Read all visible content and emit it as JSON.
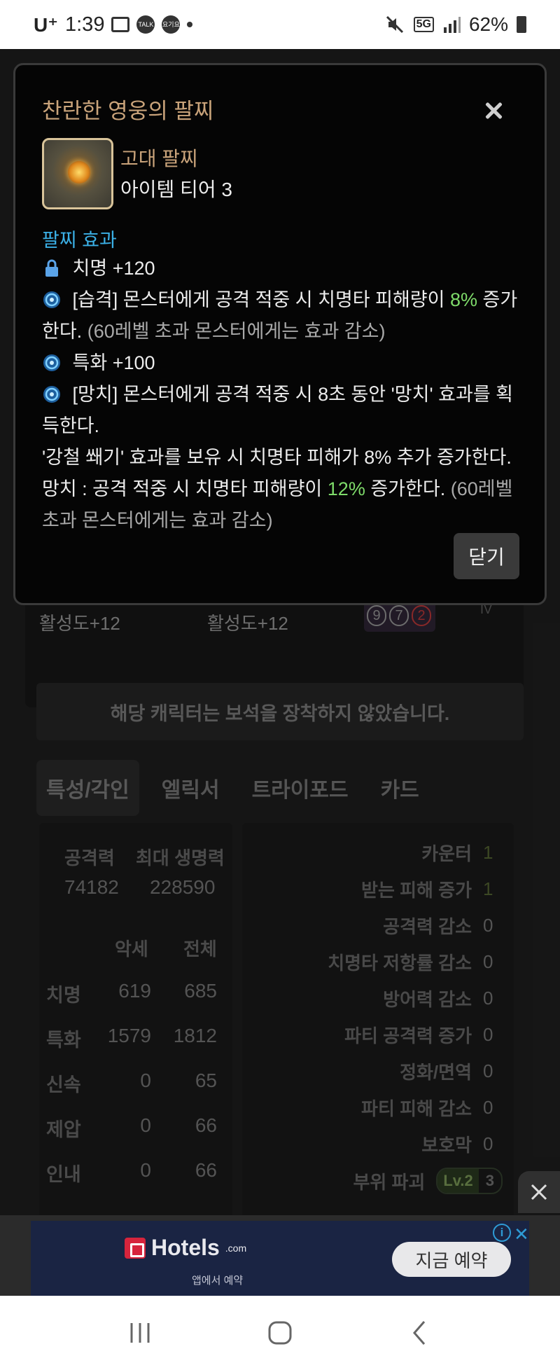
{
  "status_bar": {
    "carrier": "U⁺",
    "time": "1:39",
    "network": "5G",
    "battery": "62%",
    "icons": [
      "image-icon",
      "talk-icon",
      "yogiyo-icon",
      "dot-icon",
      "mute-icon",
      "signal-icon",
      "battery-icon"
    ],
    "talk_label": "TALK",
    "yogiyo_label": "요기요"
  },
  "background": {
    "activity_1": "활성도+12",
    "activity_2": "활성도+12",
    "gem_digits": [
      "9",
      "7",
      "2"
    ],
    "tv_label": "IV",
    "notice": "해당 캐릭터는 보석을 장착하지 않았습니다.",
    "tabs": [
      "특성/각인",
      "엘릭서",
      "트라이포드",
      "카드"
    ],
    "stats_top": {
      "attack_label": "공격력",
      "attack_value": "74182",
      "hp_label": "최대 생명력",
      "hp_value": "228590"
    },
    "stats_cols": [
      "악세",
      "전체"
    ],
    "stats_rows": [
      {
        "name": "치명",
        "acc": "619",
        "total": "685"
      },
      {
        "name": "특화",
        "acc": "1579",
        "total": "1812"
      },
      {
        "name": "신속",
        "acc": "0",
        "total": "65"
      },
      {
        "name": "제압",
        "acc": "0",
        "total": "66"
      },
      {
        "name": "인내",
        "acc": "0",
        "total": "66"
      }
    ],
    "right_stats": [
      {
        "name": "카운터",
        "value": "1"
      },
      {
        "name": "받는 피해 증가",
        "value": "1"
      },
      {
        "name": "공격력 감소",
        "value": "0"
      },
      {
        "name": "치명타 저항률 감소",
        "value": "0"
      },
      {
        "name": "방어력 감소",
        "value": "0"
      },
      {
        "name": "파티 공격력 증가",
        "value": "0"
      },
      {
        "name": "정화/면역",
        "value": "0"
      },
      {
        "name": "파티 피해 감소",
        "value": "0"
      },
      {
        "name": "보호막",
        "value": "0"
      }
    ],
    "part_break": {
      "name": "부위 파괴",
      "level": "Lv.2",
      "value": "3"
    }
  },
  "modal": {
    "title": "찬란한 영웅의 팔찌",
    "item_type": "고대 팔찌",
    "item_tier": "아이템 티어 3",
    "section_label": "팔찌 효과",
    "effects": {
      "crit": "치명 +120",
      "ambush_a": "[습격] 몬스터에게 공격 적중 시 치명타 피해량이 ",
      "ambush_pct": "8%",
      "ambush_b": " 증가",
      "ambush_c": "한다.",
      "ambush_note": "(60레벨 초과 몬스터에게는 효과 감소)",
      "spec": "특화 +100",
      "hammer_a": "[망치] 몬스터에게 공격 적중 시 8초 동안 '망치' 효과를 획",
      "hammer_b": "득한다.",
      "hammer_c": "'강철 쐐기' 효과를 보유 시 치명타 피해가 8% 추가 증가한다.",
      "hammer_d": "망치 : 공격 적중 시 치명타 피해량이 ",
      "hammer_pct": "12%",
      "hammer_e": " 증가한다.",
      "hammer_note_a": "(60레벨",
      "hammer_note_b": "초과 몬스터에게는 효과 감소)"
    },
    "close_button": "닫기"
  },
  "ad": {
    "brand": "Hotels",
    "brand_suffix": ".com",
    "subtitle": "앱에서 예약",
    "cta": "지금 예약"
  },
  "colors": {
    "title_gold": "#c9a37a",
    "effect_blue": "#3bb0e6",
    "highlight_green": "#7edb6a"
  }
}
